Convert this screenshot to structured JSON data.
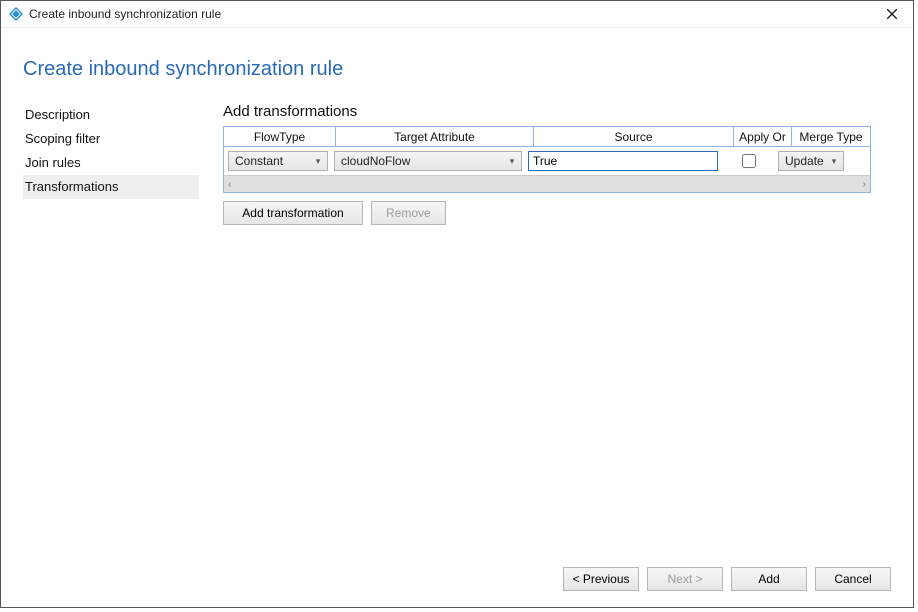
{
  "window": {
    "title": "Create inbound synchronization rule",
    "close_icon": "close-icon"
  },
  "page": {
    "title": "Create inbound synchronization rule"
  },
  "sidebar": {
    "items": [
      {
        "label": "Description",
        "selected": false
      },
      {
        "label": "Scoping filter",
        "selected": false
      },
      {
        "label": "Join rules",
        "selected": false
      },
      {
        "label": "Transformations",
        "selected": true
      }
    ]
  },
  "main": {
    "section_heading": "Add transformations",
    "columns": {
      "flowtype": "FlowType",
      "target": "Target Attribute",
      "source": "Source",
      "applyor": "Apply Or",
      "merge": "Merge Type"
    },
    "row": {
      "flowtype_value": "Constant",
      "target_value": "cloudNoFlow",
      "source_value": "True",
      "apply_once_checked": false,
      "merge_value": "Update"
    },
    "buttons": {
      "add_transformation": "Add transformation",
      "remove": "Remove"
    }
  },
  "footer": {
    "previous": "< Previous",
    "next": "Next >",
    "add": "Add",
    "cancel": "Cancel"
  }
}
